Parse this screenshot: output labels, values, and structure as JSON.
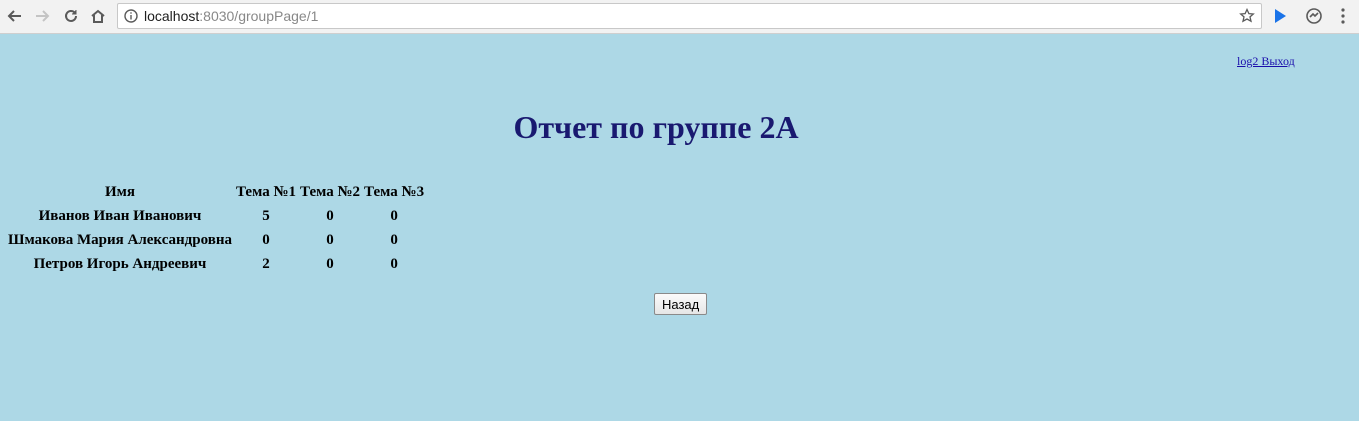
{
  "browser": {
    "url_host": "localhost",
    "url_rest": ":8030/groupPage/1"
  },
  "page": {
    "user_link": "log2 Выход",
    "title": "Отчет по группе 2А",
    "table": {
      "headers": [
        "Имя",
        "Тема №1",
        "Тема №2",
        "Тема №3"
      ],
      "rows": [
        [
          "Иванов Иван Иванович",
          "5",
          "0",
          "0"
        ],
        [
          "Шмакова Мария Александровна",
          "0",
          "0",
          "0"
        ],
        [
          "Петров Игорь Андреевич",
          "2",
          "0",
          "0"
        ]
      ]
    },
    "back_button": "Назад"
  },
  "colors": {
    "background": "#add8e6",
    "title": "#191970",
    "link": "#1a0dab"
  }
}
